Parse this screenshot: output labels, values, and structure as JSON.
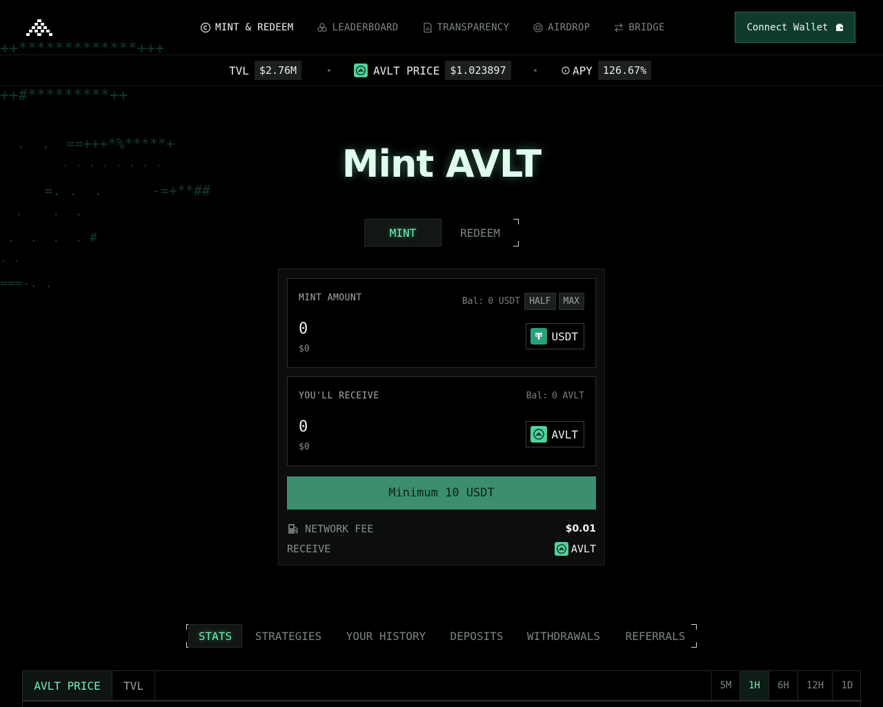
{
  "nav": {
    "items": [
      {
        "label": "MINT & REDEEM",
        "icon": "copyright-circle-icon",
        "active": true
      },
      {
        "label": "LEADERBOARD",
        "icon": "trefoil-icon",
        "active": false
      },
      {
        "label": "TRANSPARENCY",
        "icon": "document-chart-icon",
        "active": false
      },
      {
        "label": "AIRDROP",
        "icon": "target-icon",
        "active": false
      },
      {
        "label": "BRIDGE",
        "icon": "swap-arrows-icon",
        "active": false
      }
    ],
    "connect_label": "Connect Wallet"
  },
  "stats": {
    "tvl_label": "TVL",
    "tvl_value": "$2.76M",
    "price_label": "AVLT PRICE",
    "price_value": "$1.023897",
    "apy_label": "APY",
    "apy_value": "126.67%"
  },
  "title": "Mint AVLT",
  "mode_toggle": {
    "mint": "MINT",
    "redeem": "REDEEM",
    "active": "MINT"
  },
  "mint_box": {
    "label": "MINT AMOUNT",
    "balance_prefix": "Bal:",
    "balance_value": "0 USDT",
    "half_label": "HALF",
    "max_label": "MAX",
    "amount": "0",
    "usd": "$0",
    "token": "USDT"
  },
  "receive_box": {
    "label": "YOU'LL RECEIVE",
    "balance_prefix": "Bal:",
    "balance_value": "0 AVLT",
    "amount": "0",
    "usd": "$0",
    "token": "AVLT"
  },
  "cta_label": "Minimum 10 USDT",
  "fee": {
    "label": "NETWORK FEE",
    "value": "$0.01"
  },
  "receive_row": {
    "label": "RECEIVE",
    "value": "AVLT"
  },
  "lower_tabs": [
    "STATS",
    "STRATEGIES",
    "YOUR HISTORY",
    "DEPOSITS",
    "WITHDRAWALS",
    "REFERRALS"
  ],
  "chart_tabs": [
    "AVLT PRICE",
    "TVL"
  ],
  "ranges": [
    "5M",
    "1H",
    "6H",
    "12H",
    "1D"
  ],
  "colors": {
    "accent": "#6ff2b8",
    "cta": "#3c8e6f",
    "connect_bg": "#0f3b2d",
    "usdt": "#26a17b",
    "avlt": "#4fd19b"
  }
}
